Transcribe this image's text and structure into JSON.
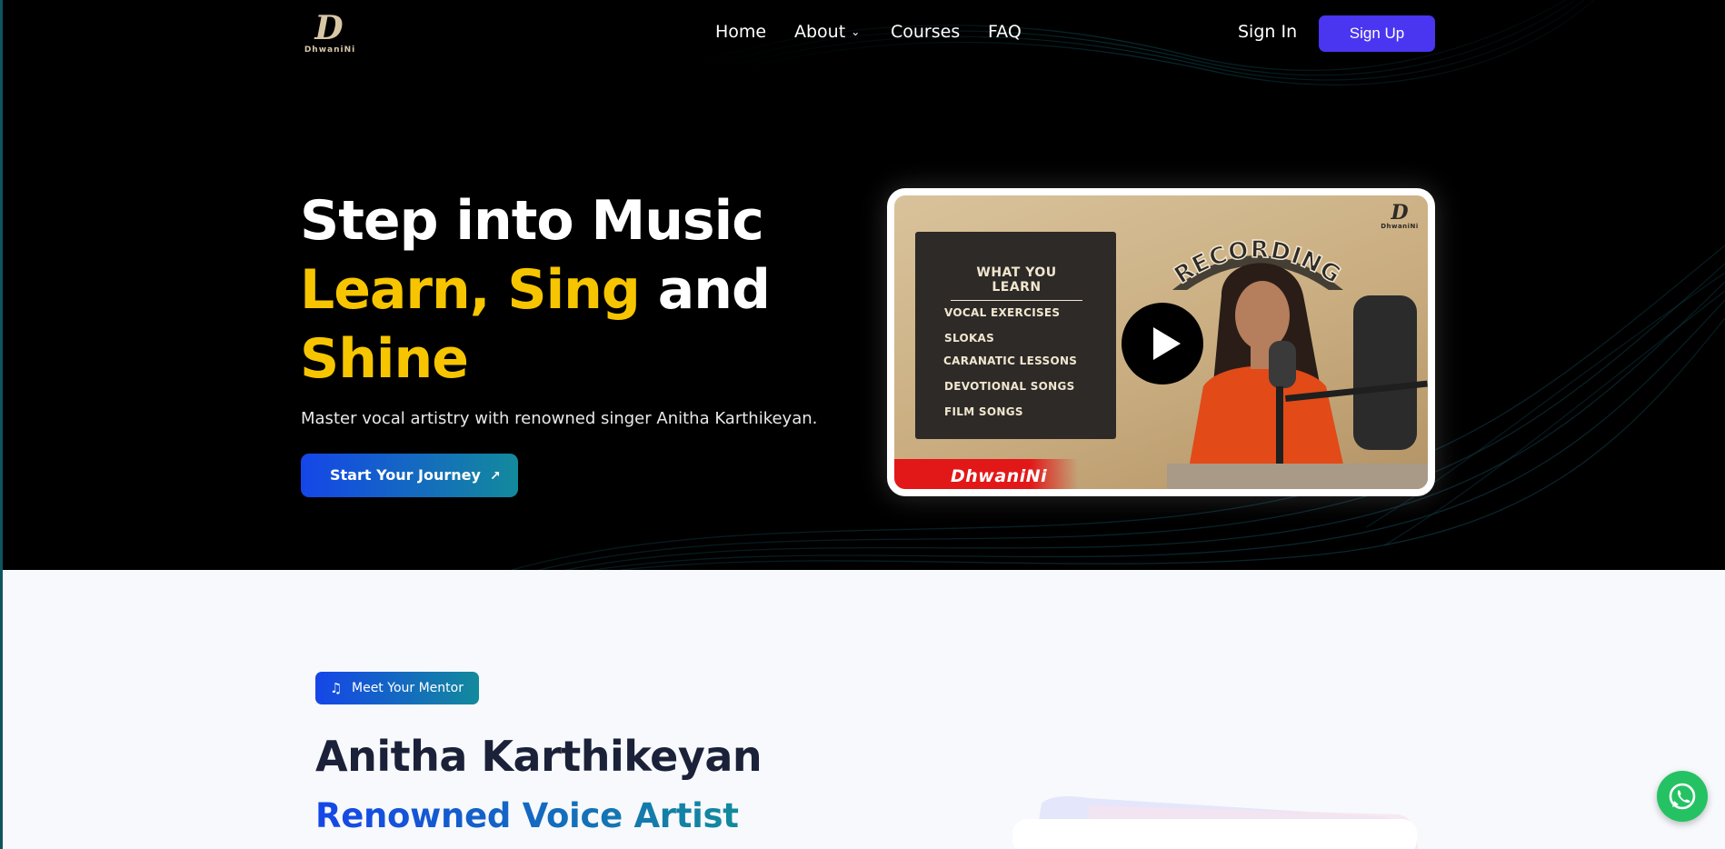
{
  "brand": {
    "logo_mark": "D",
    "logo_text": "DhwaniNi"
  },
  "nav": {
    "links": [
      {
        "label": "Home"
      },
      {
        "label": "About",
        "has_dropdown": true
      },
      {
        "label": "Courses"
      },
      {
        "label": "FAQ"
      }
    ],
    "sign_in": "Sign In",
    "sign_up": "Sign Up"
  },
  "hero": {
    "title_line1": "Step into Music",
    "title_learn": "Learn,",
    "title_sing": "Sing",
    "title_and": "and",
    "title_shine": "Shine",
    "subtitle": "Master vocal artistry with renowned singer Anitha Karthikeyan.",
    "cta_label": "Start Your Journey",
    "cta_icon": "arrow-up-right-icon"
  },
  "video": {
    "board_title": "WHAT YOU LEARN",
    "board_items": [
      "VOCAL EXERCISES",
      "SLOKAS",
      "CARANATIC LESSONS",
      "DEVOTIONAL SONGS",
      "FILM SONGS"
    ],
    "sign_text": "RECORDING",
    "strip_text": "DhwaniNi",
    "mini_logo_mark": "D",
    "mini_logo_text": "DhwaniNi",
    "play_icon": "play-icon"
  },
  "mentor": {
    "badge_label": "Meet Your Mentor",
    "badge_icon": "music-note-icon",
    "name": "Anitha Karthikeyan",
    "role": "Renowned Voice Artist"
  },
  "floating": {
    "whatsapp_icon": "whatsapp-icon"
  },
  "colors": {
    "hero_bg": "#000000",
    "accent_yellow": "#f7c500",
    "signup_purple": "#4a35f0",
    "gradient_start": "#1546e8",
    "gradient_end": "#138a9c",
    "whatsapp_green": "#25c263",
    "strip_red": "#e21818"
  }
}
